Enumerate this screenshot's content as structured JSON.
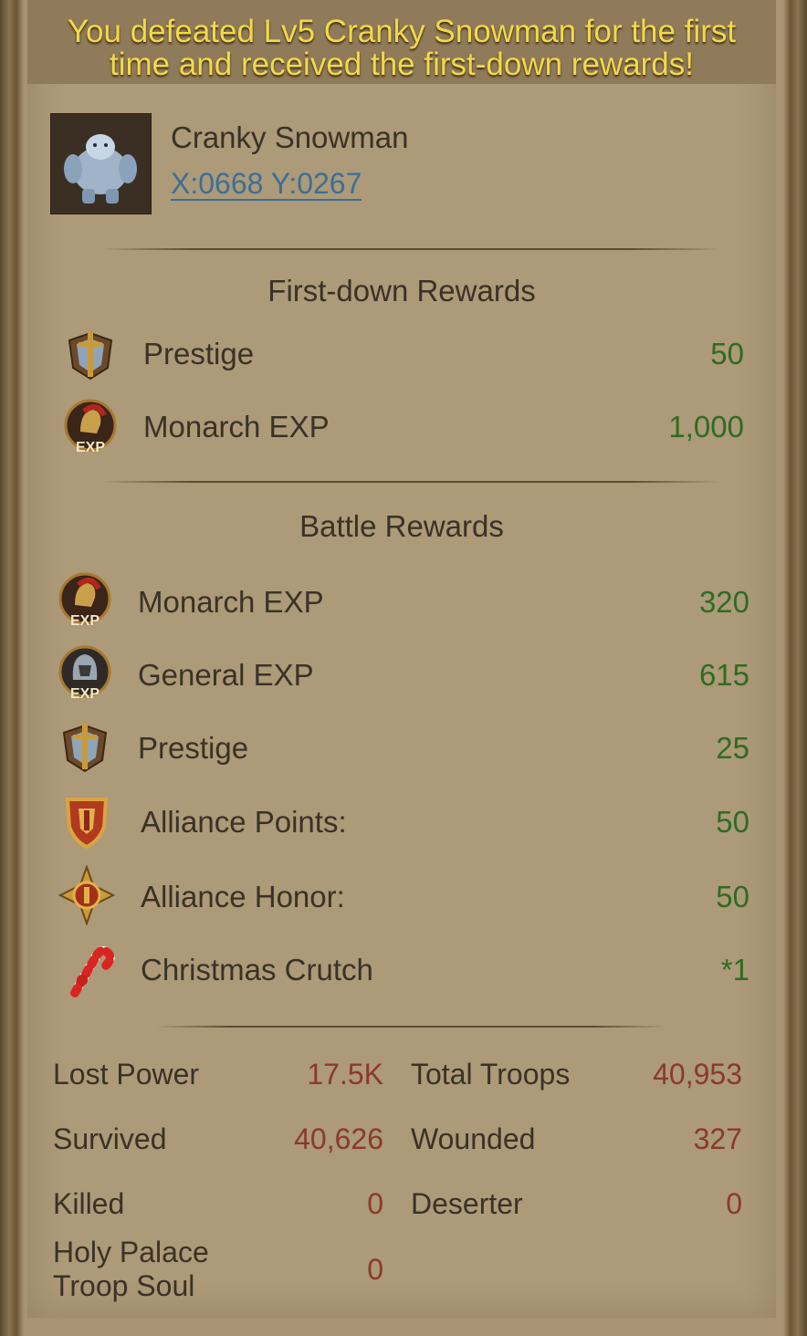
{
  "banner": {
    "line1": "You defeated Lv5 Cranky Snowman for the first",
    "line2": "time and received the first-down rewards!"
  },
  "target": {
    "name": "Cranky Snowman",
    "coords": "X:0668 Y:0267"
  },
  "first_down": {
    "title": "First-down Rewards",
    "items": [
      {
        "icon": "prestige-icon",
        "label": "Prestige",
        "value": "50"
      },
      {
        "icon": "monarch-exp-icon",
        "label": "Monarch EXP",
        "value": "1,000"
      }
    ]
  },
  "battle": {
    "title": "Battle Rewards",
    "items": [
      {
        "icon": "monarch-exp-icon",
        "label": "Monarch EXP",
        "value": "320"
      },
      {
        "icon": "general-exp-icon",
        "label": "General EXP",
        "value": "615"
      },
      {
        "icon": "prestige-icon",
        "label": "Prestige",
        "value": "25"
      },
      {
        "icon": "alliance-points-icon",
        "label": "Alliance Points:",
        "value": "50"
      },
      {
        "icon": "alliance-honor-icon",
        "label": "Alliance Honor:",
        "value": "50"
      },
      {
        "icon": "christmas-crutch-icon",
        "label": "Christmas Crutch",
        "value": "*1"
      }
    ]
  },
  "stats": {
    "lost_power_label": "Lost Power",
    "lost_power": "17.5K",
    "total_troops_label": "Total Troops",
    "total_troops": "40,953",
    "survived_label": "Survived",
    "survived": "40,626",
    "wounded_label": "Wounded",
    "wounded": "327",
    "killed_label": "Killed",
    "killed": "0",
    "deserter_label": "Deserter",
    "deserter": "0",
    "holy_palace_line1": "Holy Palace",
    "holy_palace_line2": "Troop Soul",
    "holy_palace": "0"
  },
  "colors": {
    "banner_text": "#f2d94a",
    "link": "#3c6e96",
    "reward_value": "#2f6b22",
    "stat_value": "#8a3a2a"
  }
}
